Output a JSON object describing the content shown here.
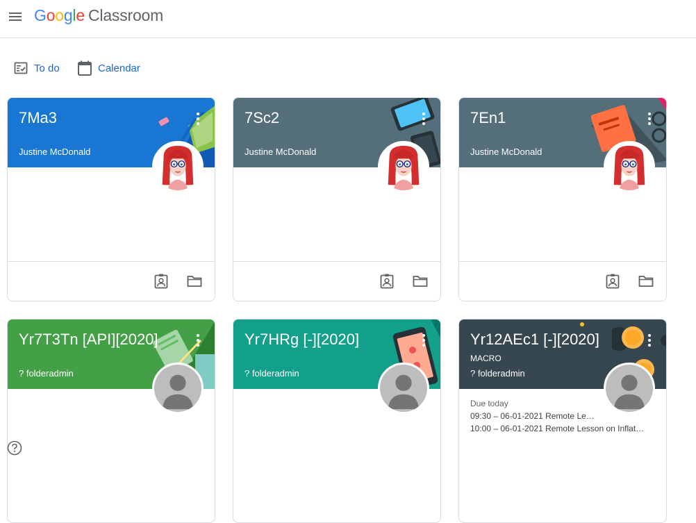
{
  "colors": {
    "accent": "#1967d2",
    "card_blue": "#1976d2",
    "card_slate": "#546e7a",
    "card_green": "#43a047",
    "card_teal": "#12a08a",
    "card_dark": "#37474f"
  },
  "header": {
    "menu_icon": "hamburger-menu-icon",
    "logo_google": [
      "G",
      "o",
      "o",
      "g",
      "l",
      "e"
    ],
    "product_name": "Classroom"
  },
  "nav": {
    "todo_label": "To do",
    "todo_icon": "assignment-check-icon",
    "calendar_label": "Calendar",
    "calendar_icon": "calendar-icon"
  },
  "cards": [
    {
      "title": "7Ma3",
      "section": "",
      "teacher": "Justine McDonald",
      "theme": "blue",
      "avatar": "teacher-avatar"
    },
    {
      "title": "7Sc2",
      "section": "",
      "teacher": "Justine McDonald",
      "theme": "slate",
      "avatar": "teacher-avatar"
    },
    {
      "title": "7En1",
      "section": "",
      "teacher": "Justine McDonald",
      "theme": "slate",
      "avatar": "teacher-avatar"
    },
    {
      "title": "Yr7T3Tn [API][2020]",
      "section": "",
      "teacher": "? folderadmin",
      "theme": "green",
      "avatar": "default-avatar"
    },
    {
      "title": "Yr7HRg [-][2020]",
      "section": "",
      "teacher": "? folderadmin",
      "theme": "teal",
      "avatar": "default-avatar"
    },
    {
      "title": "Yr12AEc1 [-][2020]",
      "section": "MACRO",
      "teacher": "? folderadmin",
      "theme": "dark",
      "avatar": "default-avatar",
      "due": {
        "label": "Due today",
        "items": [
          "09:30 – 06-01-2021 Remote Le…",
          "10:00 – 06-01-2021 Remote Lesson on Inflat…"
        ]
      }
    }
  ],
  "footer_icons": {
    "portfolio": "assignment-ind-icon",
    "folder": "folder-icon"
  },
  "help_icon": "help-icon"
}
